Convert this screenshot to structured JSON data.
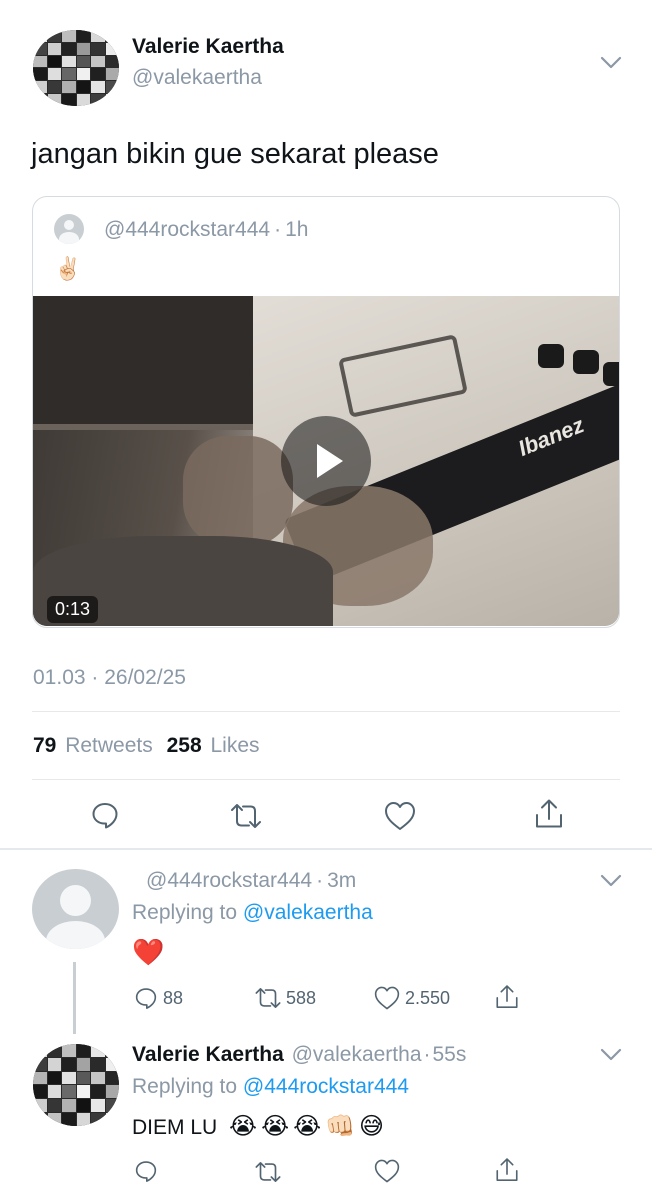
{
  "tweet": {
    "author_name": "Valerie Kaertha",
    "author_handle": "@valekaertha",
    "text": "jangan bikin gue sekarat please",
    "timestamp": "01.03 · 26/02/25",
    "retweets_count": "79",
    "retweets_label": "Retweets",
    "likes_count": "258",
    "likes_label": "Likes"
  },
  "quoted": {
    "handle": "@444rockstar444",
    "separator": "·",
    "time": "1h",
    "emoji": "✌🏻",
    "video_duration": "0:13",
    "video_overlay_text": "Ibanez"
  },
  "reply1": {
    "handle": "@444rockstar444",
    "separator": "·",
    "time": "3m",
    "replying_label": "Replying to",
    "replying_to": "@valekaertha",
    "content": "❤️",
    "reply_count": "88",
    "retweet_count": "588",
    "like_count": "2.550"
  },
  "reply2": {
    "author_name": "Valerie Kaertha",
    "handle": "@valekaertha",
    "separator": "·",
    "time": "55s",
    "replying_label": "Replying to",
    "replying_to": "@444rockstar444",
    "text": "DIEM LU",
    "emojis": "😭😭😭👊🏻😅"
  },
  "icons": [
    "reply-icon",
    "retweet-icon",
    "like-icon",
    "share-icon",
    "chevron-down-icon",
    "play-icon"
  ],
  "colors": {
    "accent": "#1d9bf0",
    "secondary_text": "#8b98a5",
    "like_heart": "#e0245e"
  }
}
